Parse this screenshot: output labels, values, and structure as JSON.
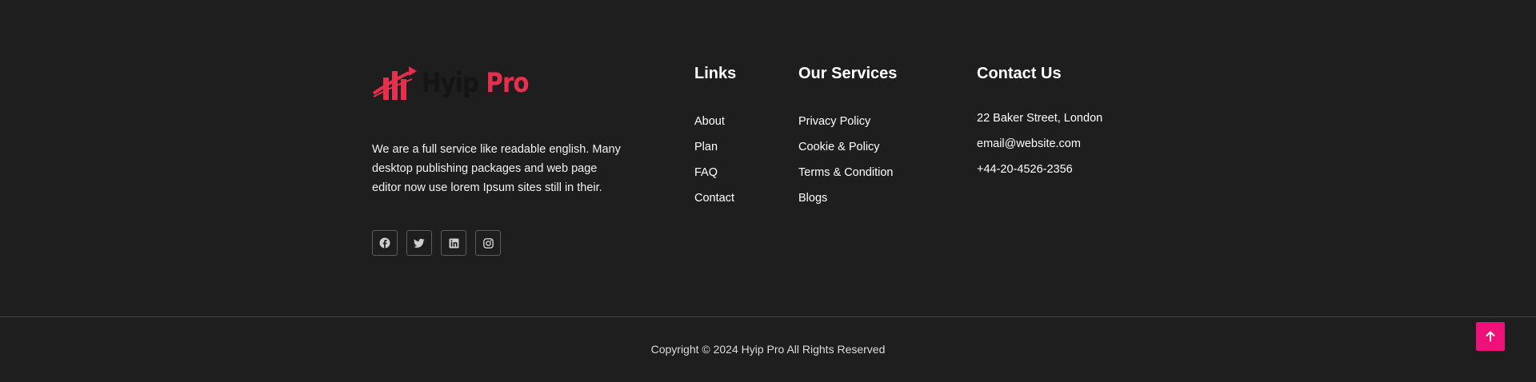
{
  "brand": {
    "logo_word1": "Hyip",
    "logo_word2": "Pro",
    "description": "We are a full service like readable english. Many desktop publishing packages and web page editor now use lorem Ipsum sites still in their.",
    "accent_color": "#e62e4d",
    "socials": [
      {
        "icon": "facebook-icon"
      },
      {
        "icon": "twitter-icon"
      },
      {
        "icon": "linkedin-icon"
      },
      {
        "icon": "instagram-icon"
      }
    ]
  },
  "links": {
    "title": "Links",
    "items": [
      "About",
      "Plan",
      "FAQ",
      "Contact"
    ]
  },
  "services": {
    "title": "Our Services",
    "items": [
      "Privacy Policy",
      "Cookie & Policy",
      "Terms & Condition",
      "Blogs"
    ]
  },
  "contact": {
    "title": "Contact Us",
    "items": [
      "22 Baker Street, London",
      "email@website.com",
      "+44-20-4526-2356"
    ]
  },
  "copyright": "Copyright © 2024 Hyip Pro All Rights Reserved",
  "scroll_top": {
    "icon": "arrow-up-icon",
    "color": "#f0107a"
  }
}
